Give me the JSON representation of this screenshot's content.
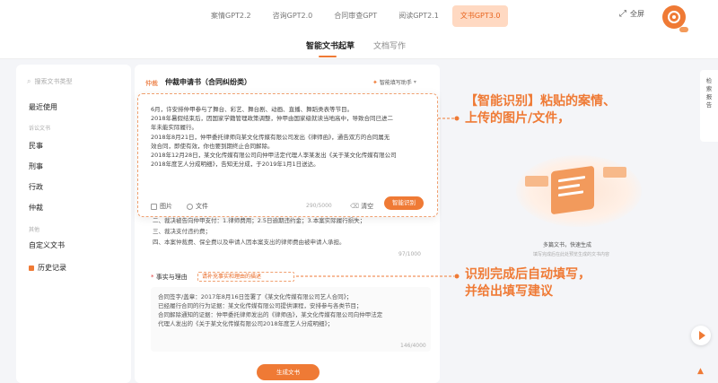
{
  "top_nav": {
    "tabs": [
      {
        "label": "案情GPT2.2",
        "active": false
      },
      {
        "label": "咨询GPT2.0",
        "active": false
      },
      {
        "label": "合同审查GPT",
        "active": false
      },
      {
        "label": "阅读GPT2.1",
        "active": false
      },
      {
        "label": "文书GPT3.0",
        "active": true
      }
    ],
    "fullscreen_label": "全屏",
    "logo_icon": "brand-logo-icon"
  },
  "sub_tabs": {
    "tabs": [
      {
        "label": "智能文书起草",
        "active": true
      },
      {
        "label": "文档写作",
        "active": false
      }
    ]
  },
  "sidebar": {
    "search_placeholder": "搜索文书类型",
    "recent_label": "最近使用",
    "group_label_1": "诉讼文书",
    "items": [
      "民事",
      "刑事",
      "行政",
      "仲裁"
    ],
    "group_label_2": "其他",
    "custom_label": "自定义文书",
    "history_label": "历史记录"
  },
  "editor": {
    "section_label": "仲裁",
    "title": "仲裁申请书（合同纠纷类）",
    "ai_helper_label": "智能填写助手",
    "paste_lines": [
      "6月，许安排仲甲参与了舞台、彩艺、舞台剧、动画、直播、舞蹈类表等节目。",
      "2018年暑假结束后，因国家学籍管理政策调整，仲甲由国家级就读当地高中，导致合同已进二",
      "年未能实际履行。",
      "2018年8月21日，仲甲委托律师向某文化传媒有限公司发出《律师函》，通告双方的合同属无",
      "效合同，即使有效，你也要到期终止合同解除。",
      "2018年12月28日，某文化传媒有限公司向仲甲法定代理人李某发出《关于某文化传媒有限公司",
      "2018年度艺人分成明细》，告知无分成，于2019年1月1日送达。"
    ],
    "paste_footer": {
      "image_label": "图片",
      "file_label": "文件",
      "counter": "290/5000",
      "clear_label": "清空",
      "recognize_label": "智能识别"
    },
    "behind_lines": [
      "二、裁决被告向仲甲支付：1.律师费用；2.5日逾期违约金；3.本案实际履行损失；",
      "三、裁决支付违约费；",
      "四、本案仲裁费、保全费以及申请人因本案支出的律师费由被申请人承担。"
    ],
    "behind_counter": "97/1000",
    "facts_label": "事实与理由",
    "facts_hint": "请补充事实和理由的描述",
    "facts_lines": [
      "合同签字/盖章：2017年8月16日签署了《某文化传媒有限公司艺人合同》；",
      "已经履行合同的行为证据：某文化传媒有限公司提供课程，安排参与各类节目；",
      "合同解除通知的证据：仲甲委托律师发出的《律师函》，某文化传媒有限公司向仲甲法定",
      "代理人发出的《关于某文化传媒有限公司2018年度艺人分成明细》；"
    ],
    "facts_counter": "146/4000",
    "generate_label": "生成文书"
  },
  "right_panel": {
    "illustration_caption": "多篇文书，快速生成",
    "illustration_sub": "填写完成后在此处预览生成的文书内容",
    "tag_left": "诉讼文书",
    "tag_right": "仲裁申请",
    "rail_text": "检索报告"
  },
  "annotations": {
    "top": [
      "【智能识别】粘贴的案情、",
      "上传的图片/文件，"
    ],
    "bottom": [
      "识别完成后自动填写，",
      "并给出填写建议"
    ]
  },
  "colors": {
    "accent": "#ef7a35",
    "accent_light": "#ffd9c2",
    "required": "#e03b3b"
  }
}
